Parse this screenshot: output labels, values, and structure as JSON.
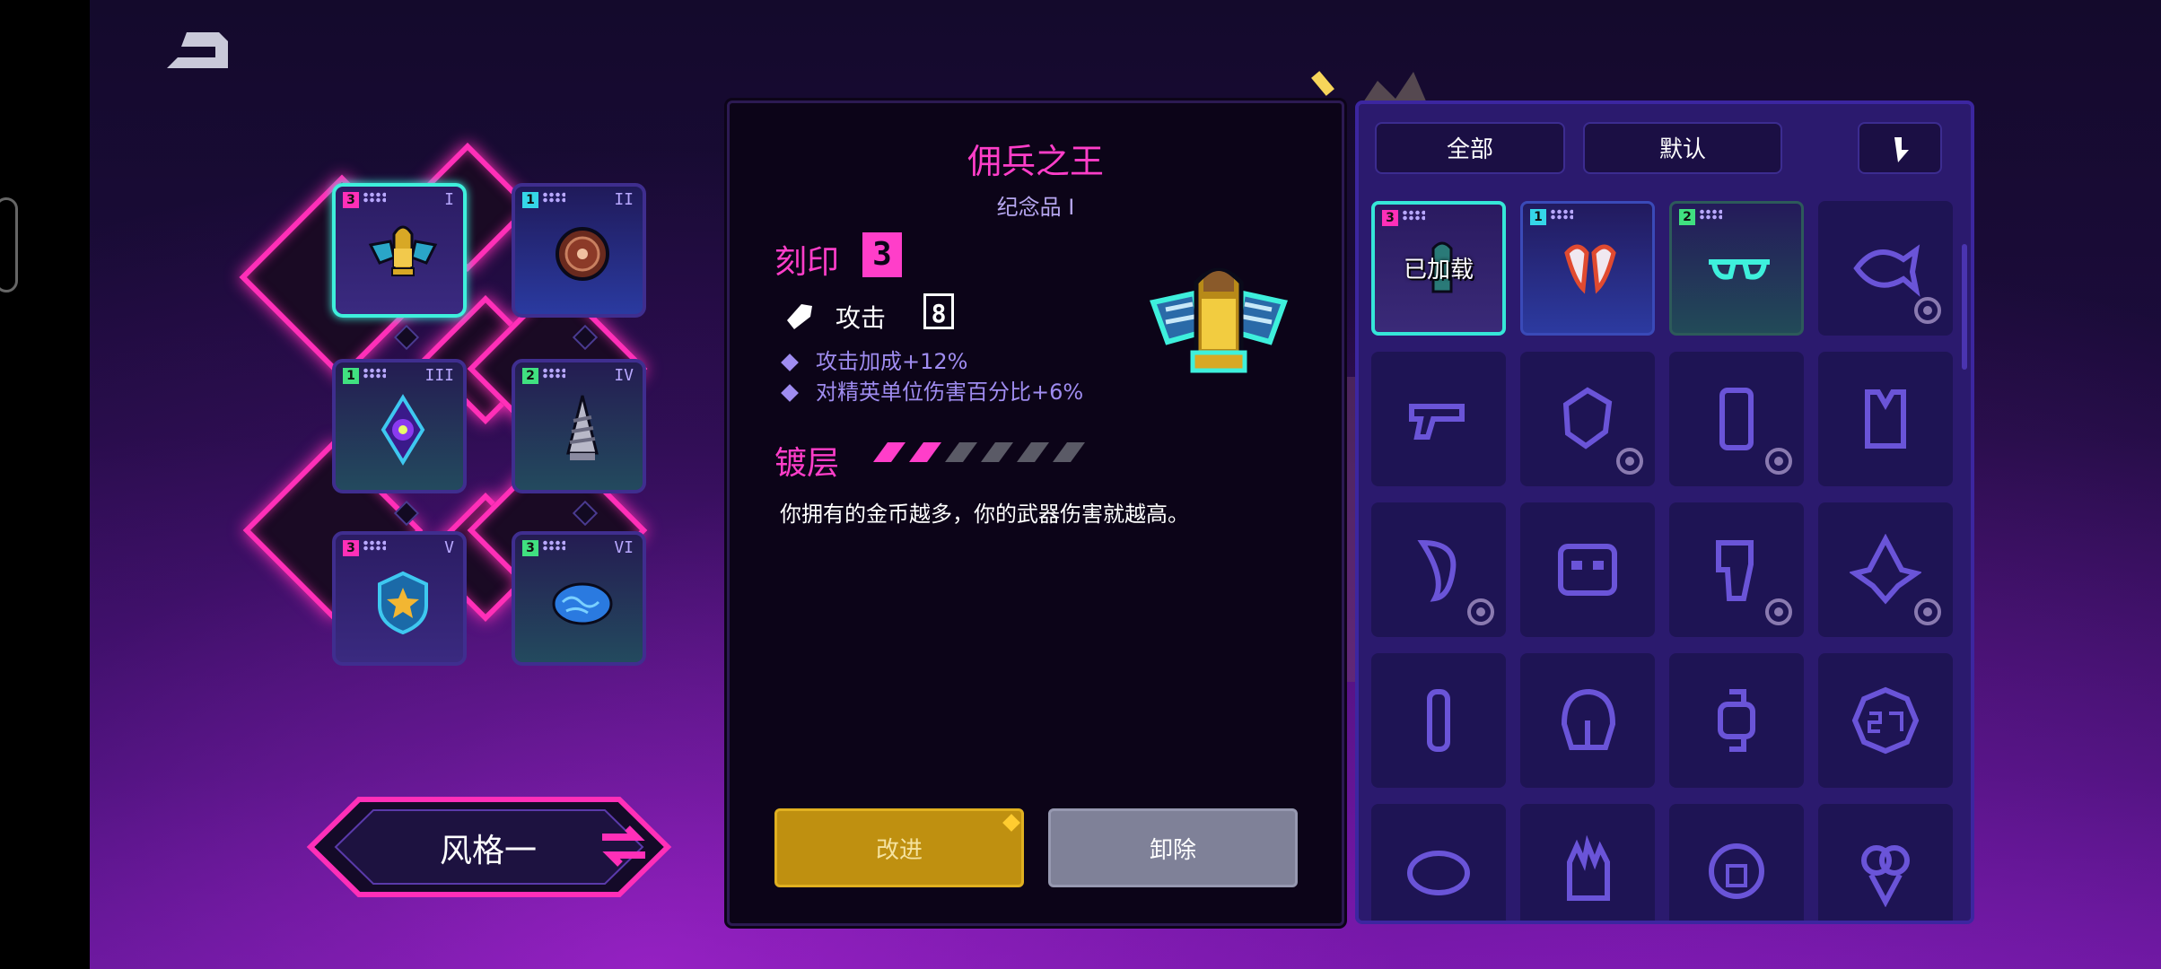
{
  "header": {
    "back_icon": "back-arrow-icon"
  },
  "board": {
    "slots": [
      {
        "level": "3",
        "numeral": "I",
        "icon": "winged-bullet-icon"
      },
      {
        "level": "1",
        "numeral": "II",
        "icon": "round-shield-icon"
      },
      {
        "level": "1",
        "numeral": "III",
        "icon": "eye-gem-icon"
      },
      {
        "level": "2",
        "numeral": "IV",
        "icon": "drill-icon"
      },
      {
        "level": "3",
        "numeral": "V",
        "icon": "star-badge-icon"
      },
      {
        "level": "3",
        "numeral": "VI",
        "icon": "brain-icon"
      }
    ]
  },
  "style": {
    "label": "风格一",
    "swap_icon": "swap-arrows-icon"
  },
  "detail": {
    "title": "佣兵之王",
    "subtitle": "纪念品 I",
    "imprint_label": "刻印",
    "imprint_level": "3",
    "attack_label": "攻击",
    "attack_level": "8",
    "stats": [
      "攻击加成+12%",
      "对精英单位伤害百分比+6%"
    ],
    "plating_label": "镀层",
    "plating": {
      "filled": 2,
      "total": 6
    },
    "description": "你拥有的金币越多，你的武器伤害就越高。",
    "upgrade_label": "改进",
    "remove_label": "卸除"
  },
  "inventory": {
    "filter_all": "全部",
    "filter_default": "默认",
    "loaded_label": "已加载",
    "items": [
      {
        "icon": "bullet-icon",
        "level": "3",
        "state": "equipped"
      },
      {
        "icon": "fangs-icon",
        "level": "1"
      },
      {
        "icon": "sunglasses-icon",
        "level": "2"
      },
      {
        "icon": "fish-icon",
        "badge": "spiral-icon"
      },
      {
        "icon": "pistol-icon"
      },
      {
        "icon": "fist-icon",
        "badge": "potion-icon"
      },
      {
        "icon": "phone-icon",
        "badge": "moon-icon"
      },
      {
        "icon": "vest-icon"
      },
      {
        "icon": "tooth-icon",
        "badge": "sun-icon"
      },
      {
        "icon": "robot-face-icon"
      },
      {
        "icon": "leg-armor-icon",
        "badge": "sparkle-icon"
      },
      {
        "icon": "bird-icon",
        "badge": "skull-icon"
      },
      {
        "icon": "vial-icon"
      },
      {
        "icon": "helmet-icon"
      },
      {
        "icon": "watch-icon"
      },
      {
        "icon": "2077-badge-icon"
      },
      {
        "icon": "brain-outline-icon"
      },
      {
        "icon": "glove-icon"
      },
      {
        "icon": "disc-icon"
      },
      {
        "icon": "ice-cream-icon"
      }
    ]
  }
}
